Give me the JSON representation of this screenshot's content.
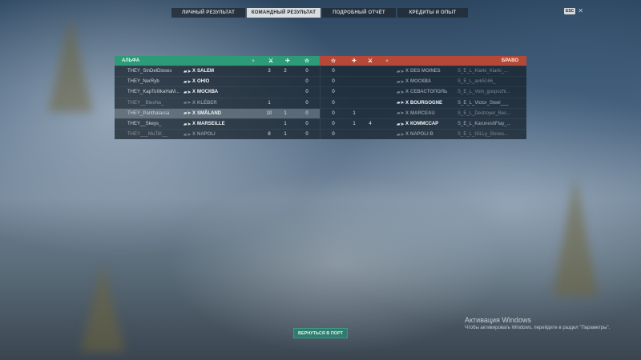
{
  "tabs": [
    {
      "label": "ЛИЧНЫЙ РЕЗУЛЬТАТ",
      "active": false
    },
    {
      "label": "КОМАНДНЫЙ РЕЗУЛЬТАТ",
      "active": true
    },
    {
      "label": "ПОДРОБНЫЙ ОТЧЁТ",
      "active": false
    },
    {
      "label": "КРЕДИТЫ И ОПЫТ",
      "active": false
    }
  ],
  "top_right": {
    "key": "ESC",
    "close": "✕"
  },
  "teams": {
    "alpha": {
      "name": "АЛЬФА",
      "color": "#2d9a78"
    },
    "bravo": {
      "name": "БРАВО",
      "color": "#b54836"
    }
  },
  "column_icons": {
    "laurel": "laurel-icon",
    "swords": "swords-icon",
    "plane": "plane-icon",
    "star": "star-icon"
  },
  "rows": [
    {
      "left": {
        "player": "THEY_SinDelDioses",
        "ship": "SALEM",
        "tier": "X",
        "c1": "3",
        "c2": "2",
        "xp": "0",
        "dim": false
      },
      "right": {
        "xp": "0",
        "c1": "",
        "c2": "",
        "ship": "DES MOINES",
        "tier": "X",
        "player": "S_E_L_Klarki_Klarki_...",
        "dim": true
      }
    },
    {
      "left": {
        "player": "THEY_NerRyb",
        "ship": "OHIO",
        "tier": "X",
        "c1": "",
        "c2": "",
        "xp": "0",
        "dim": false
      },
      "right": {
        "xp": "0",
        "c1": "",
        "c2": "",
        "ship": "МОСКВА",
        "tier": "X",
        "player": "S_E_L_avk5166_",
        "dim": true
      }
    },
    {
      "left": {
        "player": "THEY_KapToIIlkaHaM...",
        "ship": "МОСКВА",
        "tier": "X",
        "c1": "",
        "c2": "",
        "xp": "0",
        "dim": false
      },
      "right": {
        "xp": "0",
        "c1": "",
        "c2": "",
        "ship": "СЕВАСТОПОЛЬ",
        "tier": "X",
        "player": "S_E_L_Voin_gospozhi...",
        "dim": true
      }
    },
    {
      "left": {
        "player": "THEY__BlesNa_",
        "ship": "KLÉBER",
        "tier": "X",
        "c1": "1",
        "c2": "",
        "xp": "0",
        "dim": true
      },
      "right": {
        "xp": "0",
        "c1": "",
        "c2": "",
        "ship": "BOURGOGNE",
        "tier": "X",
        "player": "S_E_L_Victor_Steel___",
        "dim": false
      }
    },
    {
      "left": {
        "player": "THEY_Panthalassa",
        "ship": "SMÅLAND",
        "tier": "X",
        "c1": "10",
        "c2": "1",
        "xp": "0",
        "dim": false,
        "me": true
      },
      "right": {
        "xp": "0",
        "c1": "1",
        "c2": "",
        "ship": "MARCEAU",
        "tier": "X",
        "player": "S_E_L_Destroyer_Bes...",
        "dim": true
      }
    },
    {
      "left": {
        "player": "THEY__Skeys_",
        "ship": "MARSEILLE",
        "tier": "X",
        "c1": "",
        "c2": "1",
        "xp": "0",
        "dim": false
      },
      "right": {
        "xp": "0",
        "c1": "1",
        "c2": "4",
        "ship": "КОММССАР",
        "tier": "X",
        "player": "S_E_L_KaruneshFlay_...",
        "dim": false
      }
    },
    {
      "left": {
        "player": "THEY___MuTiK__",
        "ship": "NAPOLI",
        "tier": "X",
        "c1": "8",
        "c2": "1",
        "xp": "0",
        "dim": true
      },
      "right": {
        "xp": "0",
        "c1": "",
        "c2": "",
        "ship": "NAPOLI B",
        "tier": "X",
        "player": "S_E_L_t3iLLy_l3ones...",
        "dim": true
      }
    }
  ],
  "port_button": "ВЕРНУТЬСЯ В ПОРТ",
  "watermark": {
    "title": "Активация Windows",
    "text": "Чтобы активировать Windows, перейдите в раздел \"Параметры\"."
  }
}
